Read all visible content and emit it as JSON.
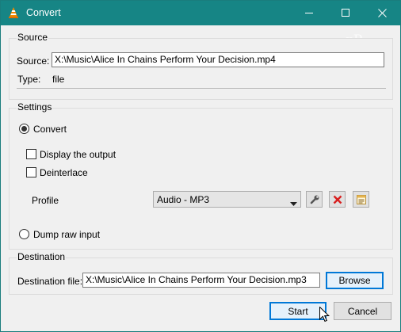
{
  "window": {
    "title": "Convert",
    "controls": [
      "minimize",
      "maximize",
      "close"
    ],
    "app_icon": "vlc-cone-icon"
  },
  "watermark": "gP",
  "source": {
    "group_title": "Source",
    "source_label": "Source:",
    "source_value": "X:\\Music\\Alice In Chains Perform Your Decision.mp4",
    "type_label": "Type:",
    "type_value": "file"
  },
  "settings": {
    "group_title": "Settings",
    "convert_label": "Convert",
    "convert_selected": true,
    "display_output_label": "Display the output",
    "display_output_checked": false,
    "deinterlace_label": "Deinterlace",
    "deinterlace_checked": false,
    "profile_label": "Profile",
    "profile_value": "Audio - MP3",
    "profile_tools": [
      "wrench-icon",
      "delete-x-icon",
      "new-profile-icon"
    ],
    "dump_raw_label": "Dump raw input",
    "dump_raw_selected": false
  },
  "destination": {
    "group_title": "Destination",
    "file_label": "Destination file:",
    "file_value": "X:\\Music\\Alice In Chains Perform Your Decision.mp3",
    "browse_label": "Browse"
  },
  "footer": {
    "start_label": "Start",
    "cancel_label": "Cancel"
  },
  "colors": {
    "titlebar": "#168585",
    "accent": "#0078d7",
    "delete_red": "#d81e1e"
  }
}
